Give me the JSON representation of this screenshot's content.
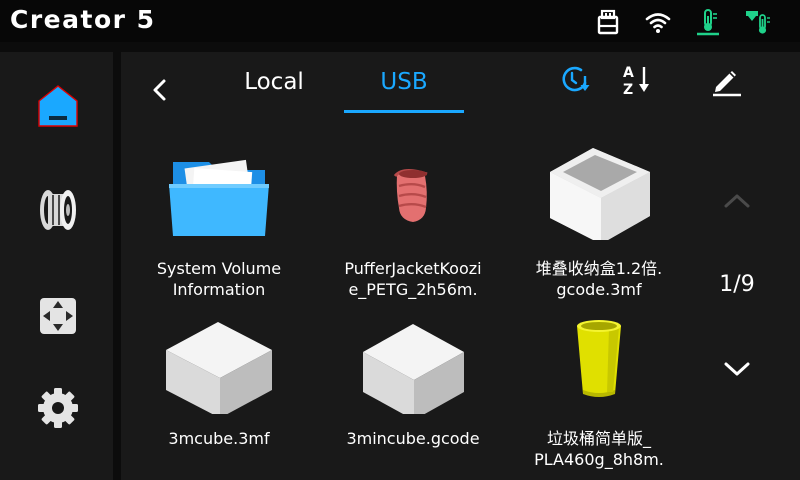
{
  "header": {
    "title": "Creator 5",
    "icons": [
      "usb-drive-icon",
      "wifi-icon",
      "bed-temperature-icon",
      "nozzle-temperature-icon"
    ],
    "accent_green": "#1fd18a"
  },
  "sidebar": {
    "items": [
      {
        "name": "home",
        "icon": "home-icon",
        "active": true
      },
      {
        "name": "filament",
        "icon": "filament-spool-icon",
        "active": false
      },
      {
        "name": "move",
        "icon": "move-axis-icon",
        "active": false
      },
      {
        "name": "settings",
        "icon": "gear-icon",
        "active": false
      }
    ]
  },
  "toolbar": {
    "tabs": [
      {
        "label": "Local",
        "active": false
      },
      {
        "label": "USB",
        "active": true
      }
    ],
    "actions": [
      "sort-by-time-icon",
      "sort-az-icon",
      "edit-icon"
    ],
    "accent_color": "#1aa8ff"
  },
  "files": {
    "items": [
      {
        "name": "System Volume\nInformation",
        "thumbnail": "folder-icon"
      },
      {
        "name": "PufferJacketKoozi\ne_PETG_2h56m.",
        "thumbnail": "koozie-model"
      },
      {
        "name": "堆叠收纳盒1.2倍.\ngcode.3mf",
        "thumbnail": "box-model"
      },
      {
        "name": "3mcube.3mf",
        "thumbnail": "cube-model"
      },
      {
        "name": "3mincube.gcode",
        "thumbnail": "cube-model"
      },
      {
        "name": "垃圾桶简单版_\nPLA460g_8h8m.",
        "thumbnail": "cylinder-model"
      }
    ]
  },
  "pagination": {
    "current": 1,
    "total": 9,
    "label": "1/9"
  }
}
